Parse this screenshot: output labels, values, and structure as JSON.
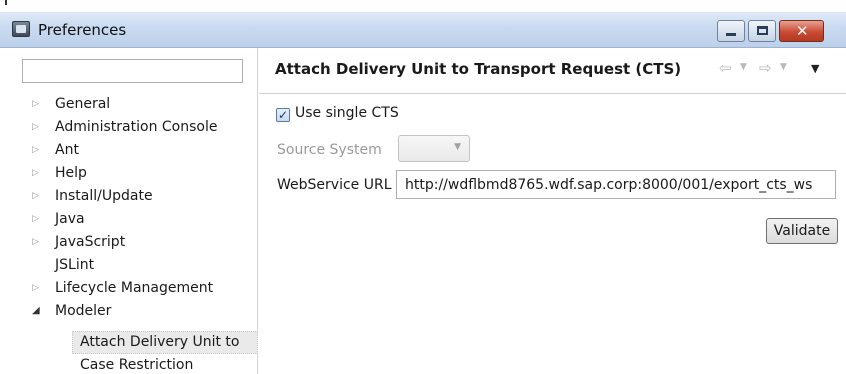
{
  "window": {
    "title": "Preferences",
    "icon": "preferences-icon",
    "controls": [
      "minimize-icon",
      "maximize-icon",
      "close-icon"
    ]
  },
  "filter": {
    "value": "",
    "placeholder": ""
  },
  "tree": {
    "items": [
      {
        "label": "General",
        "expanded": false
      },
      {
        "label": "Administration Console",
        "expanded": false
      },
      {
        "label": "Ant",
        "expanded": false
      },
      {
        "label": "Help",
        "expanded": false
      },
      {
        "label": "Install/Update",
        "expanded": false
      },
      {
        "label": "Java",
        "expanded": false
      },
      {
        "label": "JavaScript",
        "expanded": false
      },
      {
        "label": "JSLint",
        "leaf": true
      },
      {
        "label": "Lifecycle Management",
        "expanded": false
      },
      {
        "label": "Modeler",
        "expanded": true
      },
      {
        "label": "Attach Delivery Unit to",
        "child": true,
        "selected": true
      },
      {
        "label": "Case Restriction",
        "child": true
      }
    ]
  },
  "page": {
    "title": "Attach Delivery Unit to Transport Request (CTS)",
    "nav_icons": [
      "back-arrow-icon",
      "dropdown-icon",
      "forward-arrow-icon",
      "dropdown-icon",
      "view-menu-icon"
    ],
    "use_single_cts": {
      "label": "Use single CTS",
      "checked": true
    },
    "source_system": {
      "label": "Source System",
      "value": "",
      "enabled": false
    },
    "webservice": {
      "label": "WebService URL",
      "value": "http://wdflbmd8765.wdf.sap.corp:8000/001/export_cts_ws"
    },
    "validate_label": "Validate"
  },
  "colors": {
    "titlebar": "#c9daf0",
    "close_button": "#c94b33",
    "disabled_text": "#9a9a9a"
  }
}
